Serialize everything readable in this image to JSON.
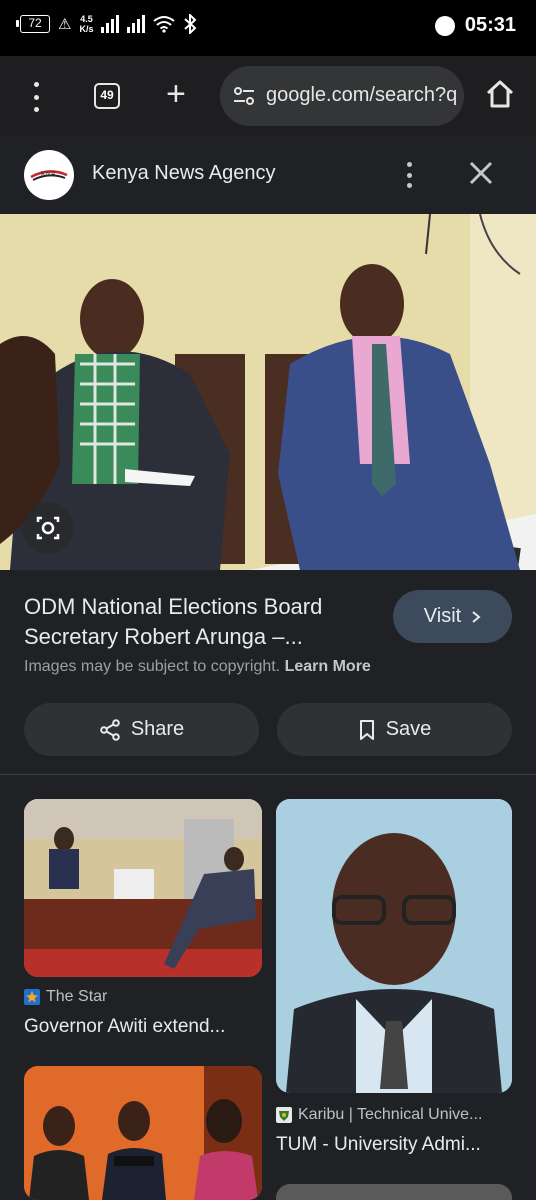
{
  "status_bar": {
    "battery": "72",
    "net_speed_value": "4.5",
    "net_speed_unit": "K/s",
    "time": "05:31"
  },
  "toolbar": {
    "tab_count": "49",
    "url": "google.com/search?q"
  },
  "source": {
    "name": "Kenya News Agency",
    "logo_text": "KNA"
  },
  "result": {
    "title": "ODM National Elections Board Secretary Robert Arunga –...",
    "visit_label": "Visit",
    "copyright_text": "Images may be subject to copyright.",
    "learn_more": "Learn More",
    "share_label": "Share",
    "save_label": "Save"
  },
  "related": [
    {
      "source": "The Star",
      "title": "Governor Awiti extend..."
    },
    {
      "source": "Karibu | Technical Unive...",
      "title": "TUM - University Admi..."
    }
  ],
  "colors": {
    "panel_bg": "#202124",
    "button_bg": "#303134",
    "visit_bg": "#3c4a5c"
  }
}
